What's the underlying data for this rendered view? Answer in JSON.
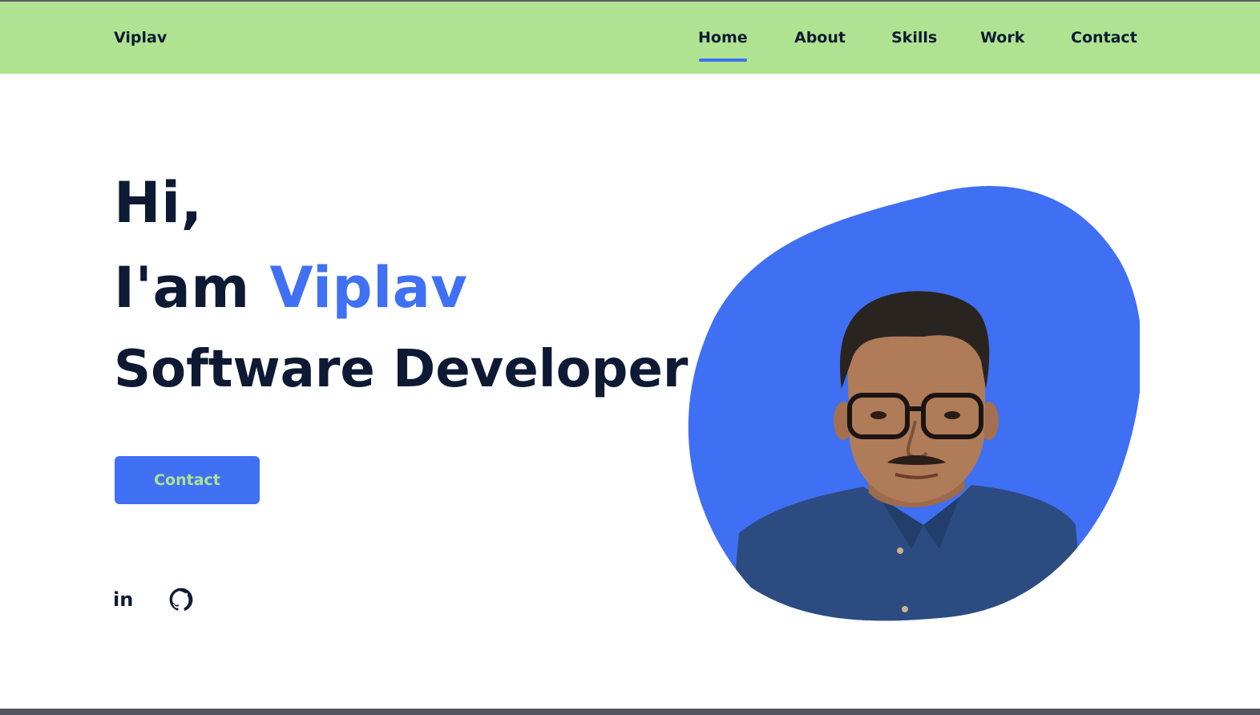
{
  "header": {
    "logo": "Viplav",
    "nav": {
      "home": "Home",
      "about": "About",
      "skills": "Skills",
      "work": "Work",
      "contact": "Contact"
    },
    "active_tab": "Home"
  },
  "hero": {
    "greeting": "Hi,",
    "intro_prefix": "I'am",
    "name": "Viplav",
    "role": "Software Developer",
    "cta_label": "Contact"
  },
  "social": {
    "linkedin_icon": "linkedin-icon",
    "linkedin_text": "in",
    "github_icon": "github-icon"
  },
  "colors": {
    "header_bg": "#afe391",
    "accent_blue": "#4070f4",
    "text_dark": "#0e1a33",
    "cta_text": "#afe391"
  }
}
